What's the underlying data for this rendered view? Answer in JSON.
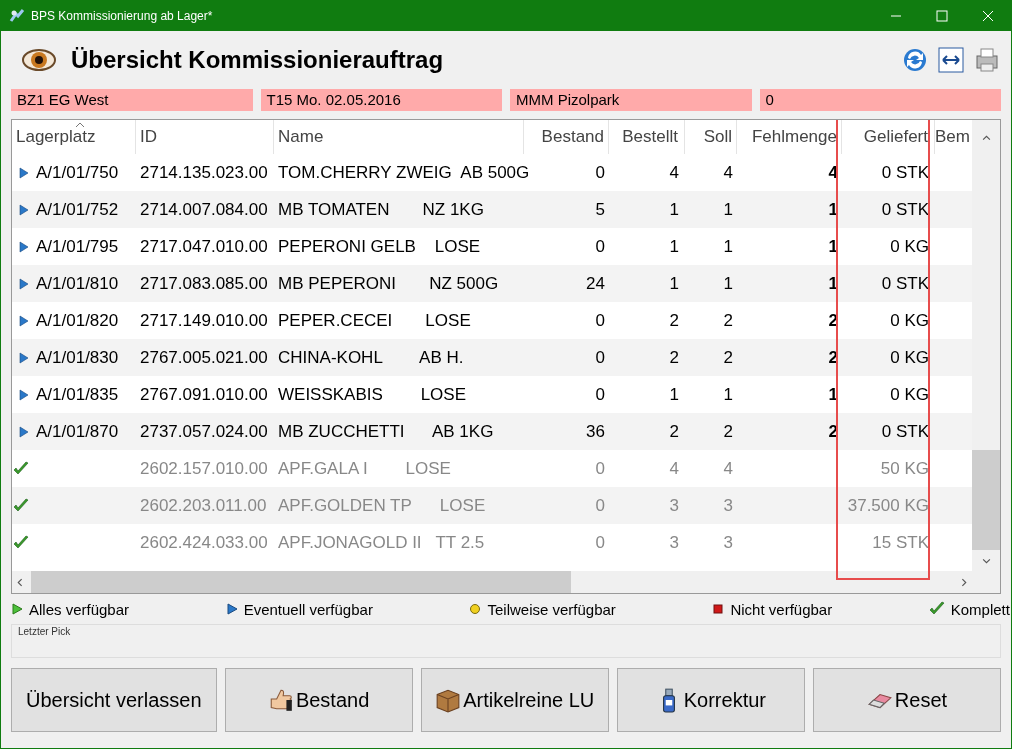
{
  "window": {
    "title": "BPS Kommissionierung ab Lager*"
  },
  "header": {
    "title": "Übersicht Kommissionierauftrag"
  },
  "info_fields": [
    "BZ1 EG West",
    "T15 Mo. 02.05.2016",
    "MMM Pizolpark",
    "0"
  ],
  "table": {
    "columns": [
      "Lagerplatz",
      "ID",
      "Name",
      "Bestand",
      "Bestellt",
      "Soll",
      "Fehlmenge",
      "Geliefert",
      "Bem"
    ],
    "rows": [
      {
        "kind": "eventuell",
        "lagerplatz": "A/1/01/750",
        "id": "2714.135.023.00",
        "name": "TOM.CHERRY ZWEIG  AB 500G",
        "bestand": "0",
        "bestellt": "4",
        "soll": "4",
        "fehlmenge": "4",
        "geliefert": "0 STK"
      },
      {
        "kind": "eventuell",
        "lagerplatz": "A/1/01/752",
        "id": "2714.007.084.00",
        "name": "MB TOMATEN       NZ 1KG",
        "bestand": "5",
        "bestellt": "1",
        "soll": "1",
        "fehlmenge": "1",
        "geliefert": "0 STK"
      },
      {
        "kind": "eventuell",
        "lagerplatz": "A/1/01/795",
        "id": "2717.047.010.00",
        "name": "PEPERONI GELB    LOSE",
        "bestand": "0",
        "bestellt": "1",
        "soll": "1",
        "fehlmenge": "1",
        "geliefert": "0 KG"
      },
      {
        "kind": "eventuell",
        "lagerplatz": "A/1/01/810",
        "id": "2717.083.085.00",
        "name": "MB PEPERONI       NZ 500G",
        "bestand": "24",
        "bestellt": "1",
        "soll": "1",
        "fehlmenge": "1",
        "geliefert": "0 STK"
      },
      {
        "kind": "eventuell",
        "lagerplatz": "A/1/01/820",
        "id": "2717.149.010.00",
        "name": "PEPER.CECEI       LOSE",
        "bestand": "0",
        "bestellt": "2",
        "soll": "2",
        "fehlmenge": "2",
        "geliefert": "0 KG"
      },
      {
        "kind": "eventuell",
        "lagerplatz": "A/1/01/830",
        "id": "2767.005.021.00",
        "name": "CHINA-KOHL        AB H.",
        "bestand": "0",
        "bestellt": "2",
        "soll": "2",
        "fehlmenge": "2",
        "geliefert": "0 KG"
      },
      {
        "kind": "eventuell",
        "lagerplatz": "A/1/01/835",
        "id": "2767.091.010.00",
        "name": "WEISSKABIS        LOSE",
        "bestand": "0",
        "bestellt": "1",
        "soll": "1",
        "fehlmenge": "1",
        "geliefert": "0 KG"
      },
      {
        "kind": "eventuell",
        "lagerplatz": "A/1/01/870",
        "id": "2737.057.024.00",
        "name": "MB ZUCCHETTI      AB 1KG",
        "bestand": "36",
        "bestellt": "2",
        "soll": "2",
        "fehlmenge": "2",
        "geliefert": "0 STK"
      },
      {
        "kind": "komplett",
        "id": "2602.157.010.00",
        "name": "APF.GALA I        LOSE",
        "bestand": "0",
        "bestellt": "4",
        "soll": "4",
        "geliefert": "50 KG"
      },
      {
        "kind": "komplett",
        "id": "2602.203.011.00",
        "name": "APF.GOLDEN TP      LOSE",
        "bestand": "0",
        "bestellt": "3",
        "soll": "3",
        "geliefert": "37.500 KG"
      },
      {
        "kind": "komplett",
        "id": "2602.424.033.00",
        "name": "APF.JONAGOLD II   TT 2.5",
        "bestand": "0",
        "bestellt": "3",
        "soll": "3",
        "geliefert": "15 STK"
      }
    ]
  },
  "legend": [
    {
      "kind": "alles",
      "label": "Alles verfügbar"
    },
    {
      "kind": "eventuell",
      "label": "Eventuell verfügbar"
    },
    {
      "kind": "teilweise",
      "label": "Teilweise verfügbar"
    },
    {
      "kind": "nicht",
      "label": "Nicht verfügbar"
    },
    {
      "kind": "komplett",
      "label": "Komplett"
    }
  ],
  "last_pick": {
    "label": "Letzter Pick"
  },
  "buttons": [
    {
      "kind": "exit",
      "label": "Übersicht verlassen"
    },
    {
      "kind": "stock",
      "label": "Bestand"
    },
    {
      "kind": "pallet",
      "label": "Artikelreine LU"
    },
    {
      "kind": "correct",
      "label": "Korrektur"
    },
    {
      "kind": "reset",
      "label": "Reset"
    }
  ]
}
